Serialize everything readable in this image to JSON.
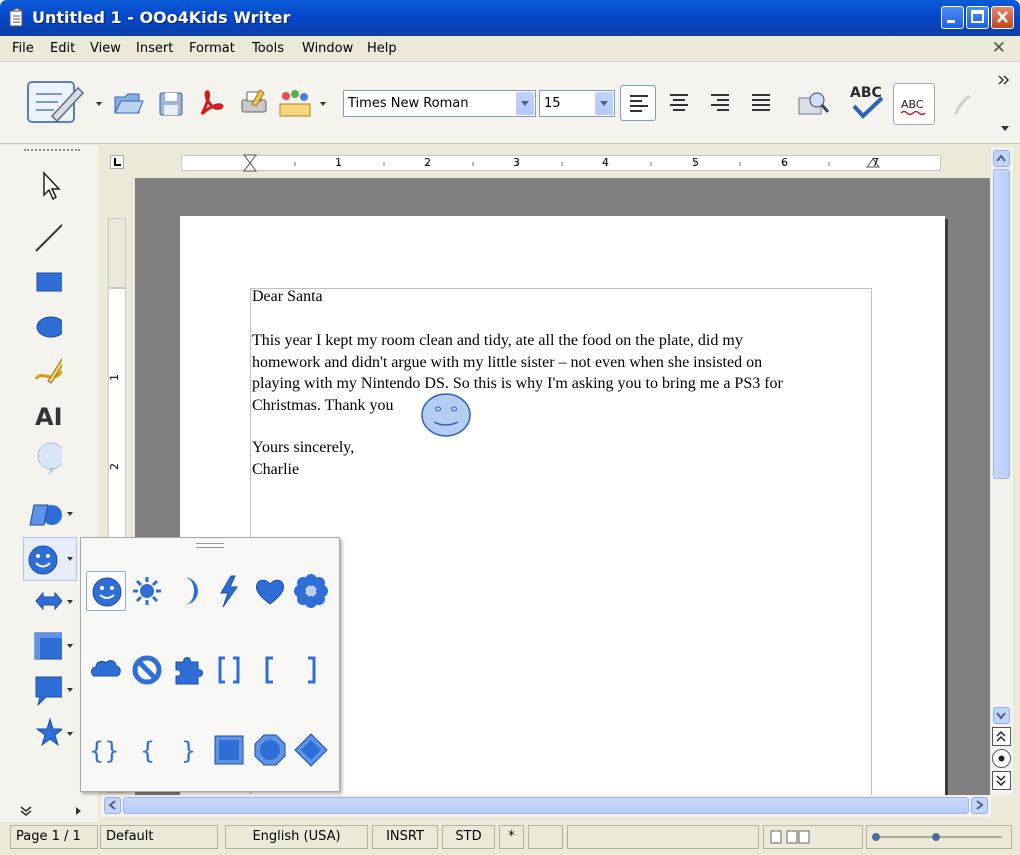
{
  "window": {
    "title": "Untitled 1 - OOo4Kids Writer"
  },
  "menu": [
    "File",
    "Edit",
    "View",
    "Insert",
    "Format",
    "Tools",
    "Window",
    "Help"
  ],
  "toolbar": {
    "font_name": "Times New Roman",
    "font_size": "15"
  },
  "ruler": {
    "h_numbers": [
      "1",
      "2",
      "3",
      "4",
      "5",
      "6",
      "7"
    ],
    "v_numbers": [
      "1",
      "2"
    ]
  },
  "document": {
    "lines": [
      "Dear Santa",
      "This year I kept my room clean and tidy, ate all the food on the plate, did my",
      "homework and didn't argue with my little sister – not even when she insisted on",
      "playing with my Nintendo DS. So this is why I'm asking you to bring me a PS3 for",
      "Christmas. Thank you",
      "Yours sincerely,",
      "Charlie"
    ]
  },
  "status": {
    "page": "Page 1 / 1",
    "style": "Default",
    "language": "English (USA)",
    "mode": "INSRT",
    "selection": "STD",
    "modified": "*"
  },
  "colors": {
    "accent": "#2f6ed6",
    "shape_fill": "#b4cdf0",
    "shape_stroke": "#2c62bd"
  }
}
